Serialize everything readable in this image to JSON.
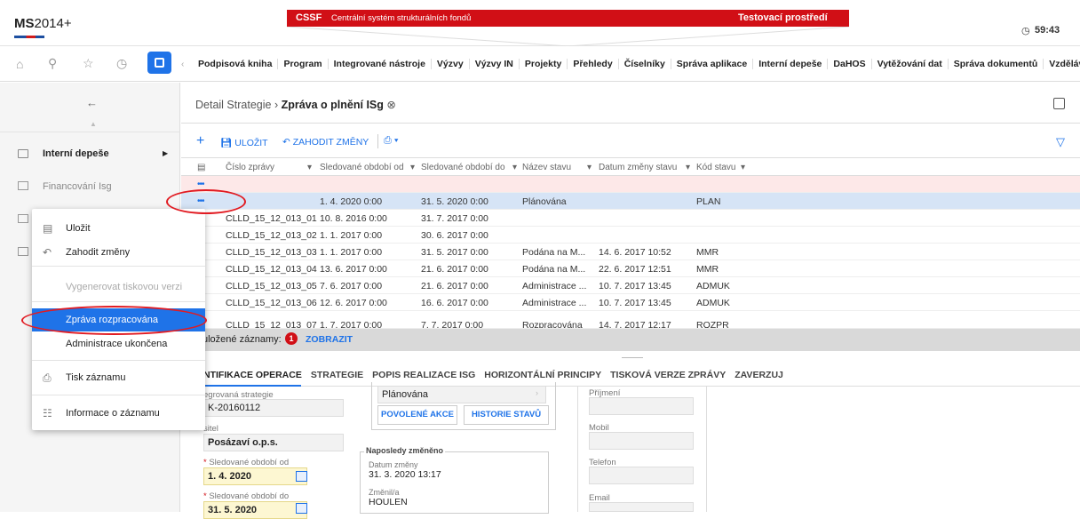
{
  "header": {
    "logo_bold": "MS",
    "logo_rest": "2014+",
    "system_short": "CSSF",
    "system_full": "Centrální systém strukturálních fondů",
    "environment": "Testovací prostředí",
    "session_timer": "59:43"
  },
  "nav": {
    "menu": [
      "Podpisová kniha",
      "Program",
      "Integrované nástroje",
      "Výzvy",
      "Výzvy IN",
      "Projekty",
      "Přehledy",
      "Číselníky",
      "Správa aplikace",
      "Interní depeše",
      "DaHOS",
      "Vytěžování dat",
      "Správa dokumentů",
      "Vzdělávání"
    ]
  },
  "sidebar": {
    "items": [
      {
        "label": "Interní depeše"
      },
      {
        "label": "Financování Isg"
      }
    ]
  },
  "popup": {
    "items": [
      {
        "label": "Uložit",
        "icon": "save-icon"
      },
      {
        "label": "Zahodit změny",
        "icon": "undo-icon"
      },
      {
        "label": "Vygenerovat tiskovou verzi"
      },
      {
        "label": "Zpráva rozpracována"
      },
      {
        "label": "Administrace ukončena"
      },
      {
        "label": "Tisk záznamu",
        "icon": "print-icon"
      },
      {
        "label": "Informace o záznamu",
        "icon": "info-icon"
      }
    ]
  },
  "breadcrumb": {
    "parent": "Detail Strategie",
    "current": "Zpráva o plnění ISg"
  },
  "toolbar": {
    "save": "ULOŽIT",
    "discard": "ZAHODIT ZMĚNY"
  },
  "table": {
    "columns": [
      "Číslo zprávy",
      "Sledované období od",
      "Sledované období do",
      "Název stavu",
      "Datum změny stavu",
      "Kód stavu"
    ],
    "rows": [
      {
        "cislo": "",
        "od": "1. 4. 2020 0:00",
        "do": "31. 5. 2020 0:00",
        "nazev": "Plánována",
        "datum": "",
        "kod": "PLAN"
      },
      {
        "cislo": "CLLD_15_12_013_01",
        "od": "10. 8. 2016 0:00",
        "do": "31. 7. 2017 0:00",
        "nazev": "",
        "datum": "",
        "kod": ""
      },
      {
        "cislo": "CLLD_15_12_013_02",
        "od": "1. 1. 2017 0:00",
        "do": "30. 6. 2017 0:00",
        "nazev": "",
        "datum": "",
        "kod": ""
      },
      {
        "cislo": "CLLD_15_12_013_03",
        "od": "1. 1. 2017 0:00",
        "do": "31. 5. 2017 0:00",
        "nazev": "Podána na M...",
        "datum": "14. 6. 2017 10:52",
        "kod": "MMR"
      },
      {
        "cislo": "CLLD_15_12_013_04",
        "od": "13. 6. 2017 0:00",
        "do": "21. 6. 2017 0:00",
        "nazev": "Podána na M...",
        "datum": "22. 6. 2017 12:51",
        "kod": "MMR"
      },
      {
        "cislo": "CLLD_15_12_013_05",
        "od": "7. 6. 2017 0:00",
        "do": "21. 6. 2017 0:00",
        "nazev": "Administrace ...",
        "datum": "10. 7. 2017 13:45",
        "kod": "ADMUK"
      },
      {
        "cislo": "CLLD_15_12_013_06",
        "od": "12. 6. 2017 0:00",
        "do": "16. 6. 2017 0:00",
        "nazev": "Administrace ...",
        "datum": "10. 7. 2017 13:45",
        "kod": "ADMUK"
      },
      {
        "cislo": "CLLD_15_12_013_07",
        "od": "1. 7. 2017 0:00",
        "do": "7. 7. 2017 0:00",
        "nazev": "Rozpracována",
        "datum": "14. 7. 2017 12:17",
        "kod": "ROZPR"
      }
    ],
    "footer_text": "uložené záznamy:",
    "footer_count": "1",
    "footer_show": "ZOBRAZIT"
  },
  "tabs": [
    "NTIFIKACE OPERACE",
    "STRATEGIE",
    "POPIS REALIZACE ISG",
    "HORIZONTÁLNÍ PRINCIPY",
    "TISKOVÁ VERZE ZPRÁVY",
    "ZAVERZUJ"
  ],
  "form": {
    "strategy_label": "egrovaná strategie",
    "strategy_value": "K-20160112",
    "holder_label": "sitel",
    "holder_value": "Posázaví o.p.s.",
    "from_label": "Sledované období od",
    "from_value": "1. 4. 2020",
    "to_label": "Sledované období do",
    "to_value": "31. 5. 2020",
    "state_value": "Plánována",
    "btn_actions": "POVOLENÉ AKCE",
    "btn_history": "HISTORIE STAVŮ",
    "last_changed_title": "Naposledy změněno",
    "change_date_label": "Datum změny",
    "change_date_value": "31. 3. 2020 13:17",
    "changed_by_label": "Změnil/a",
    "changed_by_value": "HOULEN",
    "contact_labels": [
      "Příjmení",
      "Mobil",
      "Telefon",
      "Email"
    ]
  }
}
